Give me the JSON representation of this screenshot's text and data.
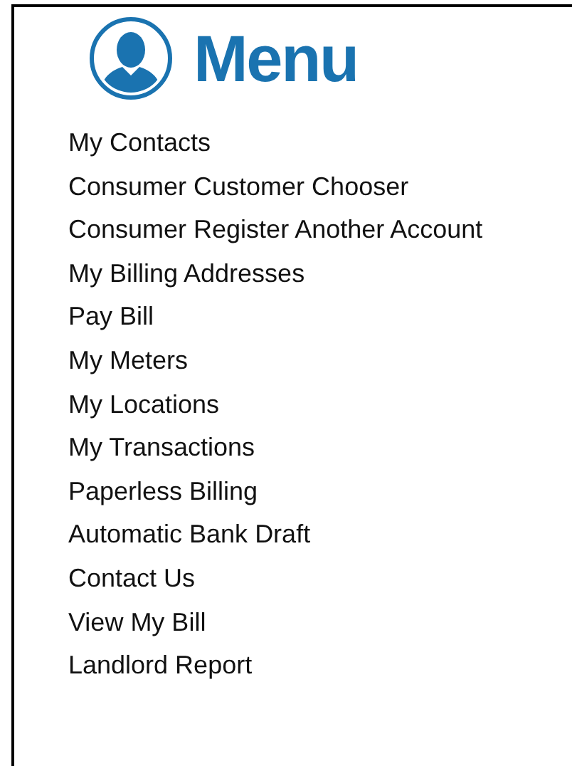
{
  "menu": {
    "title": "Menu",
    "items": [
      {
        "label": "My Contacts"
      },
      {
        "label": "Consumer Customer Chooser"
      },
      {
        "label": "Consumer Register Another Account"
      },
      {
        "label": "My Billing Addresses"
      },
      {
        "label": "Pay Bill"
      },
      {
        "label": "My Meters"
      },
      {
        "label": "My Locations"
      },
      {
        "label": "My Transactions"
      },
      {
        "label": "Paperless Billing"
      },
      {
        "label": "Automatic Bank Draft"
      },
      {
        "label": "Contact Us"
      },
      {
        "label": "View My Bill"
      },
      {
        "label": "Landlord Report"
      }
    ]
  }
}
